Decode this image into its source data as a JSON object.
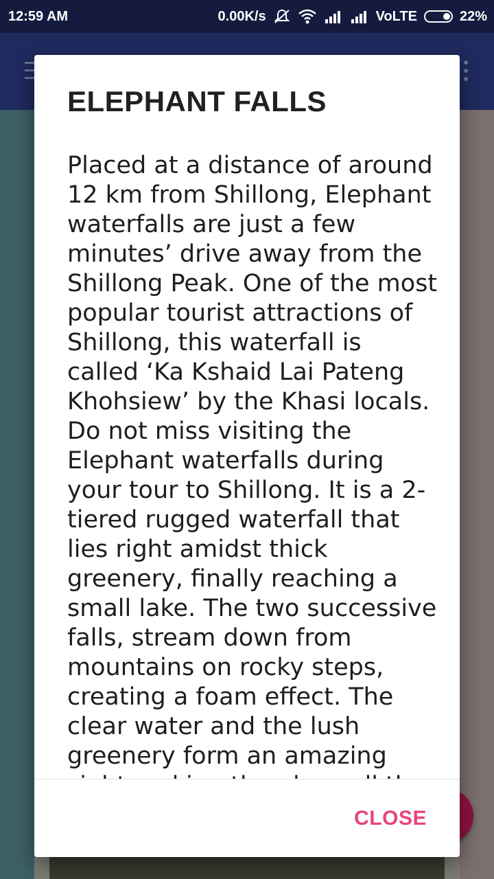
{
  "status_bar": {
    "time": "12:59 AM",
    "network_speed": "0.00K/s",
    "network_label": "VoLTE",
    "battery": "22%",
    "icons": [
      "mute-icon",
      "wifi-icon",
      "signal-icon",
      "signal-icon",
      "battery-icon"
    ]
  },
  "toolbar": {
    "icons": [
      "menu-icon",
      "more-vert-icon"
    ]
  },
  "dialog": {
    "title": "ELEPHANT FALLS",
    "body": "Placed at a distance of around 12 km from Shillong, Elephant waterfalls are just a few minutes’ drive away from the Shillong Peak. One of the most popular tourist attractions of Shillong, this waterfall is called ‘Ka Kshaid Lai Pateng Khohsiew’ by the Khasi locals. Do not miss visiting the Elephant waterfalls during your tour to Shillong. It is a 2-tiered rugged waterfall that lies right amidst thick greenery, finally reaching a small lake. The two successive falls, stream down from mountains on rocky steps, creating a foam effect. The clear water and the lush greenery form an amazing sight making the place all the more worth visiting.",
    "close_label": "CLOSE"
  },
  "colors": {
    "status_bar": "#151b3f",
    "toolbar": "#1f2a5f",
    "accent": "#e8447a"
  }
}
